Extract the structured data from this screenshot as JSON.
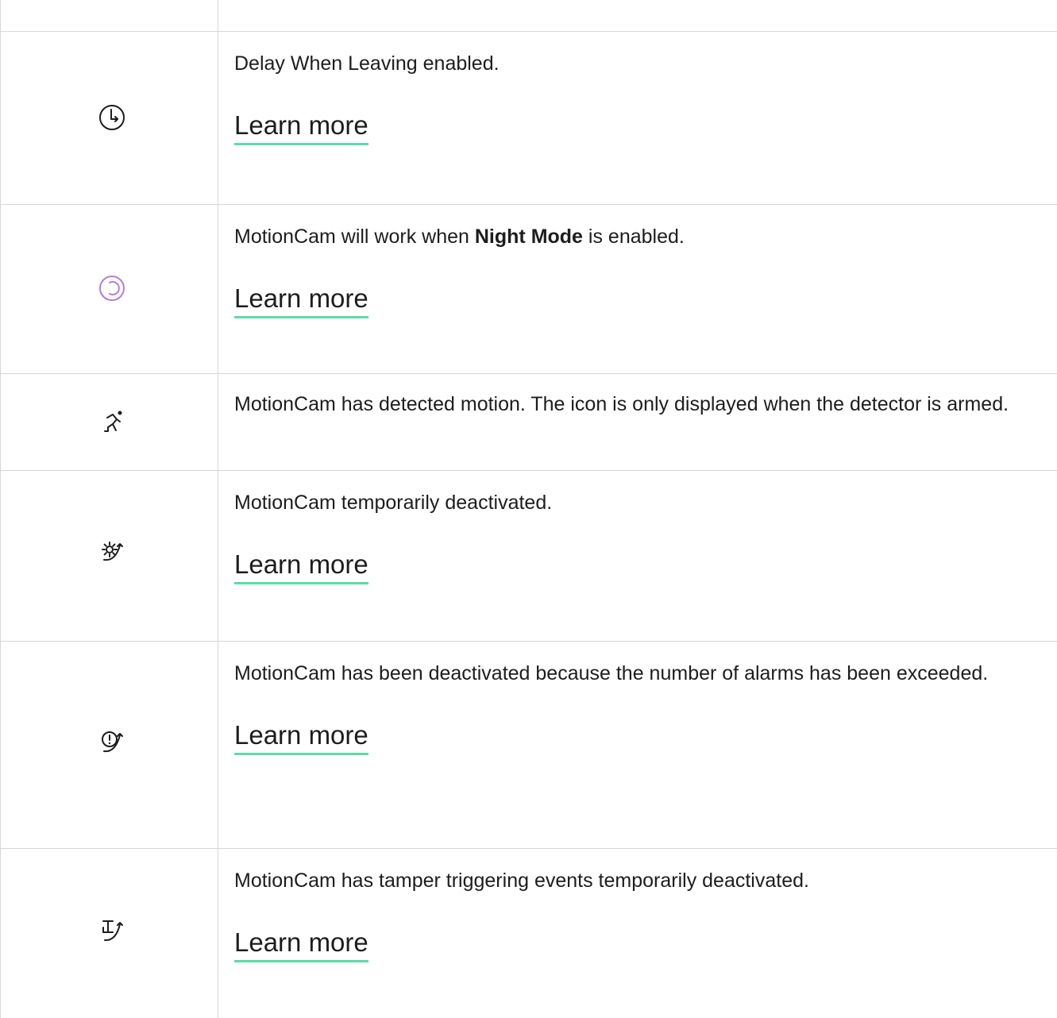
{
  "rows": [
    {
      "icon": "delay-clock-icon",
      "text": "Delay When Leaving enabled.",
      "link": "Learn more"
    },
    {
      "icon": "night-mode-icon",
      "text_before": "MotionCam will work when ",
      "text_bold": "Night Mode",
      "text_after": " is enabled.",
      "link": "Learn more",
      "icon_color": "#b07ee6"
    },
    {
      "icon": "motion-detected-icon",
      "text": "MotionCam has detected motion. The icon is only displayed when the detector is armed."
    },
    {
      "icon": "temporarily-deactivated-icon",
      "text": "MotionCam temporarily deactivated.",
      "link": "Learn more"
    },
    {
      "icon": "alarms-exceeded-deactivated-icon",
      "text": "MotionCam has been deactivated because the number of alarms has been exceeded.",
      "link": "Learn more"
    },
    {
      "icon": "tamper-deactivated-icon",
      "text": "MotionCam has tamper triggering events temporarily deactivated.",
      "link": "Learn more"
    }
  ],
  "colors": {
    "link_underline": "#5cdba8",
    "border": "#d6d6d6",
    "text": "#1d1d1d"
  }
}
